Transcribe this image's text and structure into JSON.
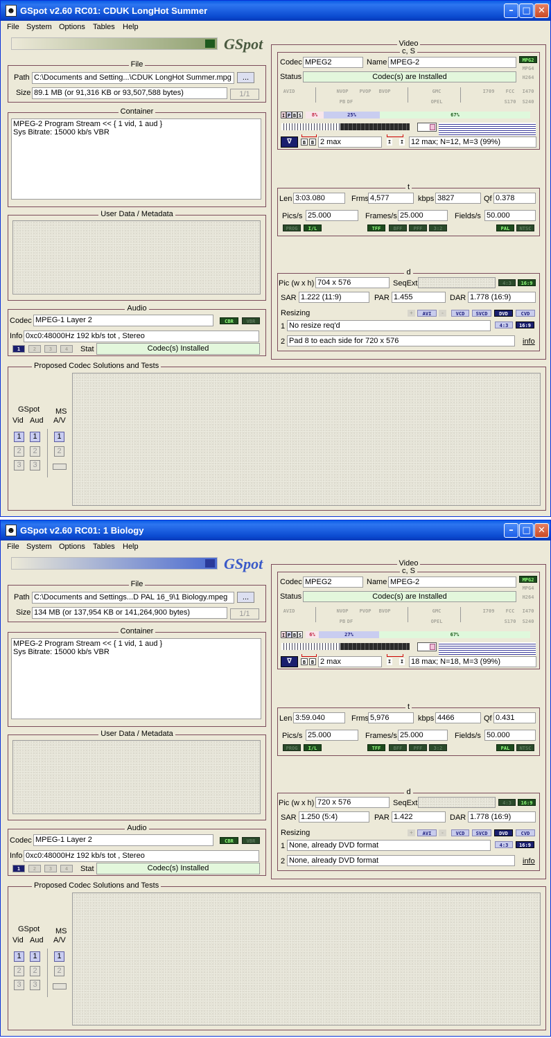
{
  "windows": [
    {
      "title": "GSpot v2.60 RC01: CDUK LongHot Summer",
      "menu": [
        "File",
        "System",
        "Options",
        "Tables",
        "Help"
      ],
      "logo": "GSpot",
      "logo_color": "#8fa070",
      "file": {
        "caption": "File",
        "path_label": "Path",
        "path": "C:\\Documents and Setting...\\CDUK LongHot Summer.mpg",
        "browse_label": "...",
        "size_label": "Size",
        "size": "89.1 MB (or 91,316 KB or 93,507,588 bytes)",
        "page": "1/1"
      },
      "container": {
        "caption": "Container",
        "line1": "MPEG-2 Program Stream << { 1 vid, 1 aud }",
        "line2": "Sys Bitrate: 15000 kb/s VBR"
      },
      "userdata": {
        "caption": "User Data / Metadata"
      },
      "audio": {
        "caption": "Audio",
        "codec_label": "Codec",
        "codec": "MPEG-1 Layer 2",
        "cbr": "CBR",
        "vbr": "VBR",
        "info_label": "Info",
        "info": "0xc0:48000Hz  192 kb/s tot , Stereo",
        "tabs": [
          "1",
          "2",
          "3",
          "4"
        ],
        "stat_label": "Stat",
        "stat": "Codec(s) Installed"
      },
      "video": {
        "caption": "Video",
        "cs_caption": "c, S",
        "codec_label": "Codec",
        "codec": "MPEG2",
        "name_label": "Name",
        "name": "MPEG-2",
        "status_label": "Status",
        "status": "Codec(s) are Installed",
        "fmt_tags": [
          "MPG2",
          "MPG4",
          "H264"
        ],
        "feat_tags": [
          "AVID",
          "NVOP",
          "PVOP",
          "BVOP",
          "GMC",
          "I709",
          "FCC",
          "I470",
          "PB",
          "DF",
          "OPEL",
          "S170",
          "S240"
        ],
        "ipbs": [
          "I",
          "P",
          "B",
          "S"
        ],
        "pct_i": "8%",
        "pct_p": "25%",
        "pct_b": "67%",
        "frac_i": 0.08,
        "frac_p": 0.25,
        "frac_b": 0.67,
        "bmax": "2 max",
        "gop": "12 max; N=12, M=3 (99%)",
        "t_caption": "t",
        "len_label": "Len",
        "len": "3:03.080",
        "frms_label": "Frms",
        "frms": "4,577",
        "kbps_label": "kbps",
        "kbps": "3827",
        "qf_label": "Qf",
        "qf": "0.378",
        "pics_label": "Pics/s",
        "pics": "25.000",
        "frames_label": "Frames/s",
        "frames": "25.000",
        "fields_label": "Fields/s",
        "fields": "50.000",
        "scan_tags": [
          "PROG",
          "I/L",
          "TFF",
          "BFF",
          "PFF",
          "3:2",
          "PAL",
          "NTSC"
        ],
        "d_caption": "d",
        "pic_label": "Pic (w x h)",
        "pic": "704 x 576",
        "seqext_label": "SeqExt",
        "ar_tags": [
          "4:3",
          "16:9"
        ],
        "sar_label": "SAR",
        "sar": "1.222 (11:9)",
        "par_label": "PAR",
        "par": "1.455",
        "dar_label": "DAR",
        "dar": "1.778 (16:9)",
        "resizing_label": "Resizing",
        "resize_tags": [
          "+",
          "AVI",
          "-",
          "VCD",
          "SVCD",
          "DVD",
          "CVD"
        ],
        "r1_label": "1",
        "r1": "No resize req'd",
        "r_ar": [
          "4:3",
          "16:9"
        ],
        "r2_label": "2",
        "r2": "Pad 8 to each side for 720 x 576",
        "info_link": "info"
      },
      "proposed": {
        "caption": "Proposed Codec Solutions and Tests",
        "gspot": "GSpot",
        "vid": "Vid",
        "aud": "Aud",
        "ms": "MS",
        "av": "A/V",
        "nums": [
          "1",
          "2",
          "3"
        ]
      }
    },
    {
      "title": "GSpot v2.60 RC01: 1 Biology",
      "menu": [
        "File",
        "System",
        "Options",
        "Tables",
        "Help"
      ],
      "logo": "GSpot",
      "logo_color": "#4a6ad0",
      "file": {
        "caption": "File",
        "path_label": "Path",
        "path": "C:\\Documents and Settings...D PAL 16_9\\1 Biology.mpeg",
        "browse_label": "...",
        "size_label": "Size",
        "size": "134 MB (or 137,954 KB or 141,264,900 bytes)",
        "page": "1/1"
      },
      "container": {
        "caption": "Container",
        "line1": "MPEG-2 Program Stream << { 1 vid, 1 aud }",
        "line2": "Sys Bitrate: 15000 kb/s VBR"
      },
      "userdata": {
        "caption": "User Data / Metadata"
      },
      "audio": {
        "caption": "Audio",
        "codec_label": "Codec",
        "codec": "MPEG-1 Layer 2",
        "cbr": "CBR",
        "vbr": "VBR",
        "info_label": "Info",
        "info": "0xc0:48000Hz  192 kb/s tot , Stereo",
        "tabs": [
          "1",
          "2",
          "3",
          "4"
        ],
        "stat_label": "Stat",
        "stat": "Codec(s) Installed"
      },
      "video": {
        "caption": "Video",
        "cs_caption": "c, S",
        "codec_label": "Codec",
        "codec": "MPEG2",
        "name_label": "Name",
        "name": "MPEG-2",
        "status_label": "Status",
        "status": "Codec(s) are Installed",
        "fmt_tags": [
          "MPG2",
          "MPG4",
          "H264"
        ],
        "feat_tags": [
          "AVID",
          "NVOP",
          "PVOP",
          "BVOP",
          "GMC",
          "I709",
          "FCC",
          "I470",
          "PB",
          "DF",
          "OPEL",
          "S170",
          "S240"
        ],
        "ipbs": [
          "I",
          "P",
          "B",
          "S"
        ],
        "pct_i": "6%",
        "pct_p": "27%",
        "pct_b": "67%",
        "frac_i": 0.06,
        "frac_p": 0.27,
        "frac_b": 0.67,
        "bmax": "2 max",
        "gop": "18 max; N=18, M=3 (99%)",
        "t_caption": "t",
        "len_label": "Len",
        "len": "3:59.040",
        "frms_label": "Frms",
        "frms": "5,976",
        "kbps_label": "kbps",
        "kbps": "4466",
        "qf_label": "Qf",
        "qf": "0.431",
        "pics_label": "Pics/s",
        "pics": "25.000",
        "frames_label": "Frames/s",
        "frames": "25.000",
        "fields_label": "Fields/s",
        "fields": "50.000",
        "scan_tags": [
          "PROG",
          "I/L",
          "TFF",
          "BFF",
          "PFF",
          "3:2",
          "PAL",
          "NTSC"
        ],
        "d_caption": "d",
        "pic_label": "Pic (w x h)",
        "pic": "720 x 576",
        "seqext_label": "SeqExt",
        "ar_tags": [
          "4:3",
          "16:9"
        ],
        "sar_label": "SAR",
        "sar": "1.250 (5:4)",
        "par_label": "PAR",
        "par": "1.422",
        "dar_label": "DAR",
        "dar": "1.778 (16:9)",
        "resizing_label": "Resizing",
        "resize_tags": [
          "+",
          "AVI",
          "-",
          "VCD",
          "SVCD",
          "DVD",
          "CVD"
        ],
        "r1_label": "1",
        "r1": "None, already DVD format",
        "r_ar": [
          "4:3",
          "16:9"
        ],
        "r2_label": "2",
        "r2": "None, already DVD format",
        "info_link": "info"
      },
      "proposed": {
        "caption": "Proposed Codec Solutions and Tests",
        "gspot": "GSpot",
        "vid": "Vid",
        "aud": "Aud",
        "ms": "MS",
        "av": "A/V",
        "nums": [
          "1",
          "2",
          "3"
        ]
      }
    }
  ]
}
